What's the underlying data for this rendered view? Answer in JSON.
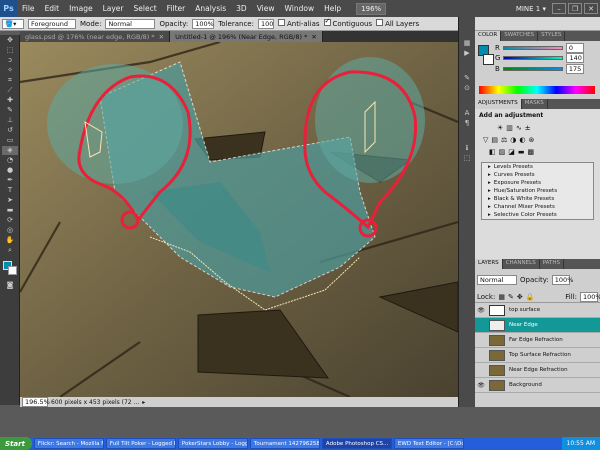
{
  "menubar": {
    "app_badge": "Ps",
    "items": [
      "File",
      "Edit",
      "Image",
      "Layer",
      "Select",
      "Filter",
      "Analysis",
      "3D",
      "View",
      "Window",
      "Help"
    ],
    "zoom": "196%",
    "workspace": "MINE 1 ▾"
  },
  "options": {
    "mode_label": "Mode:",
    "mode_value": "Normal",
    "source_value": "Foreground",
    "opacity_label": "Opacity:",
    "opacity_value": "100%",
    "tolerance_label": "Tolerance:",
    "tolerance_value": "100",
    "antialias": "Anti-alias",
    "contiguous": "Contiguous",
    "alllayers": "All Layers"
  },
  "tabs": [
    {
      "label": "glass.psd @ 176% (near edge, RGB/8) *"
    },
    {
      "label": "Untitled-1 @ 196% (Near Edge, RGB/8) *"
    }
  ],
  "status": {
    "zoom": "196.5%",
    "info": "600 pixels x 453 pixels (72 ..."
  },
  "color_panel": {
    "tabs": [
      "COLOR",
      "SWATCHES",
      "STYLES"
    ],
    "r": "0",
    "g": "140",
    "b": "175",
    "r_label": "R",
    "g_label": "G",
    "b_label": "B",
    "fg_color": "#008caf"
  },
  "adjust_panel": {
    "tabs": [
      "ADJUSTMENTS",
      "MASKS"
    ],
    "title": "Add an adjustment",
    "presets": [
      "Levels Presets",
      "Curves Presets",
      "Exposure Presets",
      "Hue/Saturation Presets",
      "Black & White Presets",
      "Channel Mixer Presets",
      "Selective Color Presets"
    ]
  },
  "layers_panel": {
    "tabs": [
      "LAYERS",
      "CHANNELS",
      "PATHS"
    ],
    "blend": "Normal",
    "opacity_label": "Opacity:",
    "opacity": "100%",
    "fill_label": "Fill:",
    "fill": "100%",
    "lock_label": "Lock:",
    "layers": [
      {
        "name": "top surface",
        "eye": true,
        "selected": false
      },
      {
        "name": "Near Edge",
        "eye": false,
        "selected": true
      },
      {
        "name": "Far Edge Refraction",
        "eye": false,
        "selected": false
      },
      {
        "name": "Top Surface Refraction",
        "eye": false,
        "selected": false
      },
      {
        "name": "Near Edge Refraction",
        "eye": false,
        "selected": false
      },
      {
        "name": "Background",
        "eye": true,
        "selected": false
      }
    ]
  },
  "taskbar": {
    "start": "Start",
    "tasks": [
      "Flickr: Search - Mozilla Fir...",
      "Full Tilt Poker - Logged In...",
      "PokerStars Lobby - Logge...",
      "Tournament 142796258 L...",
      "Adobe Photoshop CS...",
      "EWD Text Editor - [C:\\Do..."
    ],
    "clock": "10:55 AM"
  },
  "colors": {
    "accent": "#139898",
    "selection_red": "#e8203a"
  }
}
